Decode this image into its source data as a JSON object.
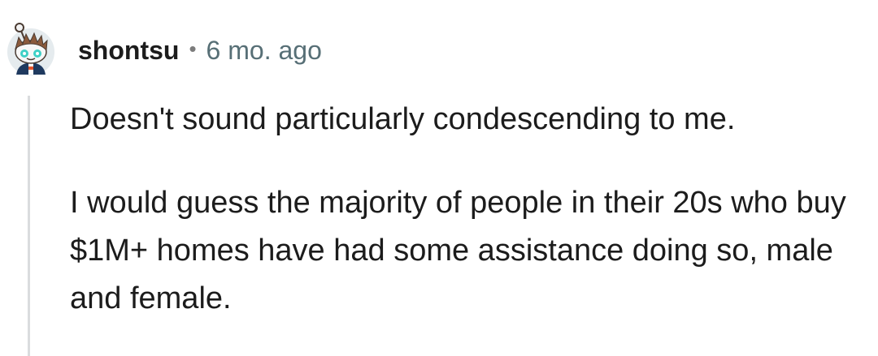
{
  "comment": {
    "author": "shontsu",
    "separator": "•",
    "timestamp": "6 mo. ago",
    "avatar_icon": "snoo-avatar-icon",
    "paragraphs": [
      "Doesn't sound particularly condescending to me.",
      "I would guess the majority of people in their 20s who buy $1M+ homes have had some assistance doing so, male and female."
    ]
  },
  "colors": {
    "text": "#1c1c1c",
    "meta": "#576f76",
    "thread_line": "#dadcde",
    "avatar_bg": "#e5ebee"
  }
}
